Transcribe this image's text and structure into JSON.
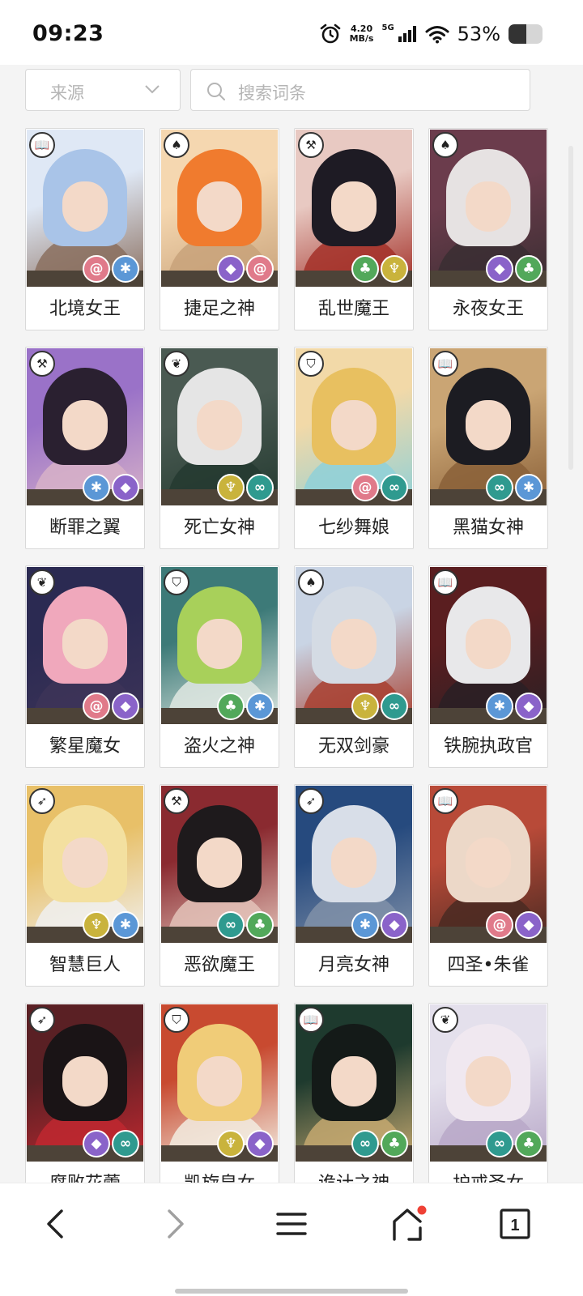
{
  "status_bar": {
    "time": "09:23",
    "net_speed_value": "4.20",
    "net_speed_unit": "MB/s",
    "network": "5G",
    "battery_percent": "53%",
    "battery_level": 0.53,
    "icons": [
      "alarm-icon",
      "signal-icon",
      "wifi-icon",
      "battery-icon"
    ]
  },
  "filters": {
    "source_label": "来源",
    "search_placeholder": "搜索词条"
  },
  "element_colors": {
    "spiral": "#e07a8a",
    "star": "#5b97d6",
    "violet": "#8a63c9",
    "leaf": "#52a85a",
    "wing": "#c9b33c",
    "wave": "#2f9a8f"
  },
  "class_glyphs": {
    "book": "📖",
    "flame": "♠",
    "hammer": "⚒",
    "shield": "⛉",
    "bow": "➶",
    "feather": "❦"
  },
  "characters": [
    {
      "name": "北境女王",
      "class": "book",
      "elements": [
        "spiral",
        "star"
      ],
      "palette": [
        "#dfe8f5",
        "#a9c4e8",
        "#8a6e5e"
      ]
    },
    {
      "name": "捷足之神",
      "class": "flame",
      "elements": [
        "violet",
        "spiral"
      ],
      "palette": [
        "#f5d7b0",
        "#f07b2e",
        "#c8a27a"
      ]
    },
    {
      "name": "乱世魔王",
      "class": "hammer",
      "elements": [
        "leaf",
        "wing"
      ],
      "palette": [
        "#e8c9c2",
        "#1e1b24",
        "#a33028"
      ]
    },
    {
      "name": "永夜女王",
      "class": "flame",
      "elements": [
        "violet",
        "leaf"
      ],
      "palette": [
        "#6b3c4c",
        "#e6e2e2",
        "#3a2e32"
      ]
    },
    {
      "name": "断罪之翼",
      "class": "hammer",
      "elements": [
        "star",
        "violet"
      ],
      "palette": [
        "#9a72c8",
        "#2a2030",
        "#d7b2c8"
      ]
    },
    {
      "name": "死亡女神",
      "class": "feather",
      "elements": [
        "wing",
        "wave"
      ],
      "palette": [
        "#4a5a52",
        "#e5e5e5",
        "#243a30"
      ]
    },
    {
      "name": "七纱舞娘",
      "class": "shield",
      "elements": [
        "spiral",
        "wave"
      ],
      "palette": [
        "#f2d9a8",
        "#e8c060",
        "#8fd0d8"
      ]
    },
    {
      "name": "黑猫女神",
      "class": "book",
      "elements": [
        "wave",
        "star"
      ],
      "palette": [
        "#caa574",
        "#1c1c22",
        "#8a6038"
      ]
    },
    {
      "name": "繁星魔女",
      "class": "feather",
      "elements": [
        "spiral",
        "violet"
      ],
      "palette": [
        "#2b2a52",
        "#f0a8bc",
        "#3d3458"
      ]
    },
    {
      "name": "盗火之神",
      "class": "shield",
      "elements": [
        "leaf",
        "star"
      ],
      "palette": [
        "#3d7a78",
        "#a8d05a",
        "#dfe8e2"
      ]
    },
    {
      "name": "无双剑豪",
      "class": "flame",
      "elements": [
        "wing",
        "wave"
      ],
      "palette": [
        "#c9d4e4",
        "#d4dbe4",
        "#a84030"
      ]
    },
    {
      "name": "铁腕执政官",
      "class": "book",
      "elements": [
        "star",
        "violet"
      ],
      "palette": [
        "#5a1e20",
        "#e8e8ea",
        "#2a2024"
      ]
    },
    {
      "name": "智慧巨人",
      "class": "bow",
      "elements": [
        "wing",
        "star"
      ],
      "palette": [
        "#e8c068",
        "#f3e0a0",
        "#f0f0f0"
      ]
    },
    {
      "name": "恶欲魔王",
      "class": "hammer",
      "elements": [
        "wave",
        "leaf"
      ],
      "palette": [
        "#8a2a30",
        "#1e1a1c",
        "#e3c2b8"
      ]
    },
    {
      "name": "月亮女神",
      "class": "bow",
      "elements": [
        "star",
        "violet"
      ],
      "palette": [
        "#264a7e",
        "#d8dee8",
        "#8090a8"
      ]
    },
    {
      "name": "四圣•朱雀",
      "class": "book",
      "elements": [
        "spiral",
        "violet"
      ],
      "palette": [
        "#b84a38",
        "#ecd8c8",
        "#4a2a22"
      ]
    },
    {
      "name": "腐败花蕾",
      "class": "bow",
      "elements": [
        "violet",
        "wave"
      ],
      "palette": [
        "#5a2024",
        "#1a1416",
        "#c02830"
      ]
    },
    {
      "name": "凯旋皇女",
      "class": "shield",
      "elements": [
        "wing",
        "violet"
      ],
      "palette": [
        "#c84a30",
        "#f0cc78",
        "#f2ece0"
      ]
    },
    {
      "name": "诡计之神",
      "class": "book",
      "elements": [
        "wave",
        "leaf"
      ],
      "palette": [
        "#1e3a2e",
        "#141a18",
        "#c4a870"
      ]
    },
    {
      "name": "护戒圣女",
      "class": "feather",
      "elements": [
        "wave",
        "leaf"
      ],
      "palette": [
        "#e4e0ec",
        "#f0e8f0",
        "#b8a8c8"
      ]
    }
  ],
  "bottom_nav": {
    "tab_count": "1",
    "home_has_notification": true
  }
}
